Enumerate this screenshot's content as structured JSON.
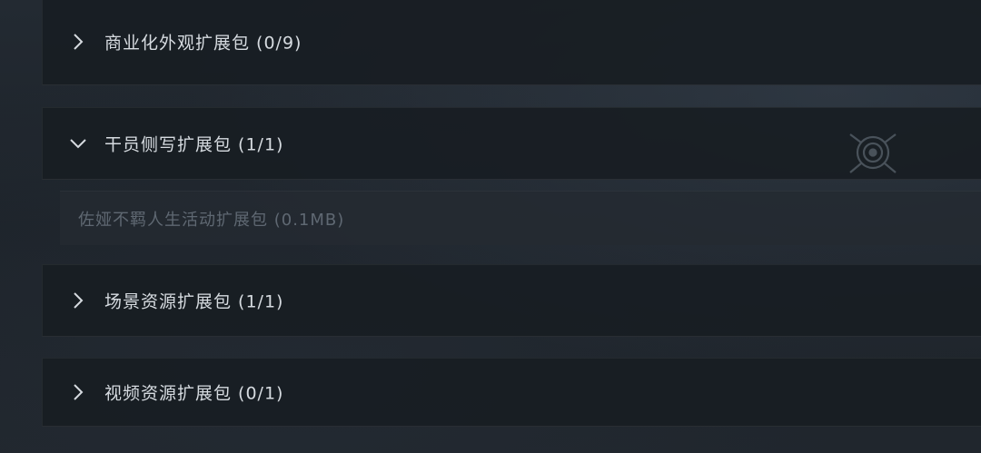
{
  "groups": [
    {
      "label": "商业化外观扩展包 (0/9)",
      "expanded": false,
      "icon": "chevron-right-icon"
    },
    {
      "label": "干员侧写扩展包 (1/1)",
      "expanded": true,
      "icon": "chevron-down-icon",
      "items": [
        {
          "label": "佐娅不羁人生活动扩展包 (0.1MB)"
        }
      ]
    },
    {
      "label": "场景资源扩展包 (1/1)",
      "expanded": false,
      "icon": "chevron-right-icon"
    },
    {
      "label": "视频资源扩展包 (0/1)",
      "expanded": false,
      "icon": "chevron-right-icon"
    }
  ],
  "watermark_icon": "target-icon",
  "colors": {
    "row_bg": "#181d23",
    "label": "#d6dbe0",
    "sub_label": "#5f6872",
    "background": "#1e242c"
  }
}
